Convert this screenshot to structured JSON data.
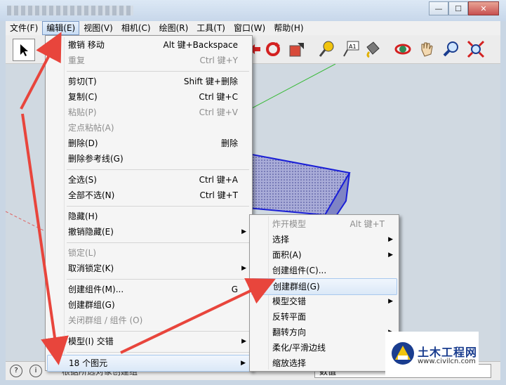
{
  "window": {
    "minimize_glyph": "—",
    "maximize_glyph": "☐",
    "close_glyph": "✕"
  },
  "menubar": [
    {
      "label": "文件(F)",
      "active": false
    },
    {
      "label": "编辑(E)",
      "active": true
    },
    {
      "label": "视图(V)",
      "active": false
    },
    {
      "label": "相机(C)",
      "active": false
    },
    {
      "label": "绘图(R)",
      "active": false
    },
    {
      "label": "工具(T)",
      "active": false
    },
    {
      "label": "窗口(W)",
      "active": false
    },
    {
      "label": "帮助(H)",
      "active": false
    }
  ],
  "toolbar": {
    "icons": [
      "select-arrow-icon",
      "move-icon",
      "rotate-icon",
      "scale-icon",
      "tape-measure-icon",
      "text-label-icon",
      "paint-bucket-icon",
      "orbit-icon",
      "pan-hand-icon",
      "zoom-icon",
      "zoom-extents-icon"
    ],
    "text_tool_glyph": "A1"
  },
  "edit_menu": [
    {
      "label": "撤销 移动",
      "shortcut": "Alt 键+Backspace",
      "disabled": false,
      "submenu": false
    },
    {
      "label": "重复",
      "shortcut": "Ctrl 键+Y",
      "disabled": true,
      "submenu": false
    },
    {
      "sep": true
    },
    {
      "label": "剪切(T)",
      "shortcut": "Shift 键+删除",
      "disabled": false,
      "submenu": false
    },
    {
      "label": "复制(C)",
      "shortcut": "Ctrl 键+C",
      "disabled": false,
      "submenu": false
    },
    {
      "label": "粘贴(P)",
      "shortcut": "Ctrl 键+V",
      "disabled": true,
      "submenu": false
    },
    {
      "label": "定点粘帖(A)",
      "shortcut": "",
      "disabled": true,
      "submenu": false
    },
    {
      "label": "删除(D)",
      "shortcut": "删除",
      "disabled": false,
      "submenu": false
    },
    {
      "label": "删除参考线(G)",
      "shortcut": "",
      "disabled": false,
      "submenu": false
    },
    {
      "sep": true
    },
    {
      "label": "全选(S)",
      "shortcut": "Ctrl 键+A",
      "disabled": false,
      "submenu": false
    },
    {
      "label": "全部不选(N)",
      "shortcut": "Ctrl 键+T",
      "disabled": false,
      "submenu": false
    },
    {
      "sep": true
    },
    {
      "label": "隐藏(H)",
      "shortcut": "",
      "disabled": false,
      "submenu": false
    },
    {
      "label": "撤销隐藏(E)",
      "shortcut": "",
      "disabled": false,
      "submenu": true
    },
    {
      "sep": true
    },
    {
      "label": "锁定(L)",
      "shortcut": "",
      "disabled": true,
      "submenu": false
    },
    {
      "label": "取消锁定(K)",
      "shortcut": "",
      "disabled": false,
      "submenu": true
    },
    {
      "sep": true
    },
    {
      "label": "创建组件(M)...",
      "shortcut": "G",
      "disabled": false,
      "submenu": false
    },
    {
      "label": "创建群组(G)",
      "shortcut": "",
      "disabled": false,
      "submenu": false
    },
    {
      "label": "关闭群组 / 组件 (O)",
      "shortcut": "",
      "disabled": true,
      "submenu": false
    },
    {
      "sep": true
    },
    {
      "label": "模型(I) 交错",
      "shortcut": "",
      "disabled": false,
      "submenu": true
    },
    {
      "sep": true
    },
    {
      "label": "18 个图元",
      "shortcut": "",
      "disabled": false,
      "submenu": true,
      "highlight": true
    }
  ],
  "context_submenu": [
    {
      "label": "炸开模型",
      "shortcut": "Alt 键+T",
      "disabled": true,
      "submenu": false
    },
    {
      "label": "选择",
      "shortcut": "",
      "disabled": false,
      "submenu": true
    },
    {
      "label": "面积(A)",
      "shortcut": "",
      "disabled": false,
      "submenu": true
    },
    {
      "label": "创建组件(C)...",
      "shortcut": "",
      "disabled": false,
      "submenu": false
    },
    {
      "label": "创建群组(G)",
      "shortcut": "",
      "disabled": false,
      "submenu": false,
      "highlight": true
    },
    {
      "label": "模型交错",
      "shortcut": "",
      "disabled": false,
      "submenu": true
    },
    {
      "label": "反转平面",
      "shortcut": "",
      "disabled": false,
      "submenu": false
    },
    {
      "label": "翻转方向",
      "shortcut": "",
      "disabled": false,
      "submenu": true
    },
    {
      "label": "柔化/平滑边线",
      "shortcut": "",
      "disabled": false,
      "submenu": false
    },
    {
      "label": "缩放选择",
      "shortcut": "",
      "disabled": false,
      "submenu": false
    }
  ],
  "statusbar": {
    "left_icon_1": "?",
    "left_icon_2": "i",
    "hint": "根据所选对象创建组",
    "measure_label": "数值"
  },
  "watermark": {
    "name": "土木工程网",
    "url": "www.civilcn.com"
  },
  "colors": {
    "annotation_arrow": "#e8453c",
    "box_face": "#7f84c4",
    "box_edge": "#1a1fd6"
  }
}
